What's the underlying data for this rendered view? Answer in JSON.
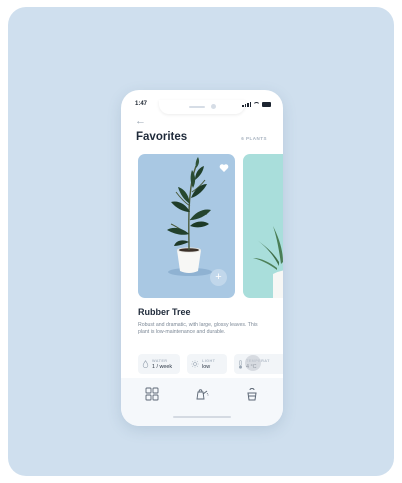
{
  "status_bar": {
    "time": "1:47"
  },
  "header": {
    "back_icon": "arrow-left-icon",
    "title": "Favorites",
    "count": "6 PLANTS"
  },
  "plant": {
    "name": "Rubber Tree",
    "description": "Robust and dramatic, with large, glossy leaves. This plant is low-maintenance and durable.",
    "card_color": "#a9c8e3",
    "next_card_color": "#a9dedb"
  },
  "care": [
    {
      "icon": "water-drop-icon",
      "label": "WATER",
      "value": "1 / week"
    },
    {
      "icon": "sun-icon",
      "label": "LIGHT",
      "value": "low"
    },
    {
      "icon": "thermometer-icon",
      "label": "TEMPERAT",
      "value": "4 °C"
    }
  ],
  "nav": [
    {
      "icon": "grid-icon",
      "label": ""
    },
    {
      "icon": "watering-can-icon",
      "label": ""
    },
    {
      "icon": "potted-plant-icon",
      "label": ""
    }
  ]
}
